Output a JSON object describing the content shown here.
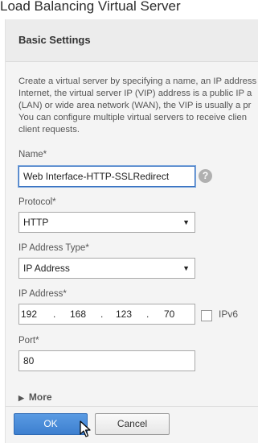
{
  "window": {
    "title": "Load Balancing Virtual Server"
  },
  "section": {
    "title": "Basic Settings"
  },
  "description": "Create a virtual server by specifying a name, an IP address\nInternet, the virtual server IP (VIP) address is a public IP a\n(LAN) or wide area network (WAN), the VIP is usually a pr\nYou can configure multiple virtual servers to receive clien\nclient requests.",
  "fields": {
    "name": {
      "label": "Name*",
      "value": "Web Interface-HTTP-SSLRedirect"
    },
    "protocol": {
      "label": "Protocol*",
      "value": "HTTP"
    },
    "ip_type": {
      "label": "IP Address Type*",
      "value": "IP Address"
    },
    "ip_address": {
      "label": "IP Address*",
      "octets": [
        "192",
        "168",
        "123",
        "70"
      ]
    },
    "ipv6": {
      "label": "IPv6",
      "checked": false
    },
    "port": {
      "label": "Port*",
      "value": "80"
    }
  },
  "help": {
    "glyph": "?"
  },
  "more": {
    "label": "More"
  },
  "buttons": {
    "ok": "OK",
    "cancel": "Cancel"
  },
  "colors": {
    "ok_button": "#3d7fcf",
    "focus": "#3b74c2",
    "panel_bg": "#f4f4f4"
  }
}
